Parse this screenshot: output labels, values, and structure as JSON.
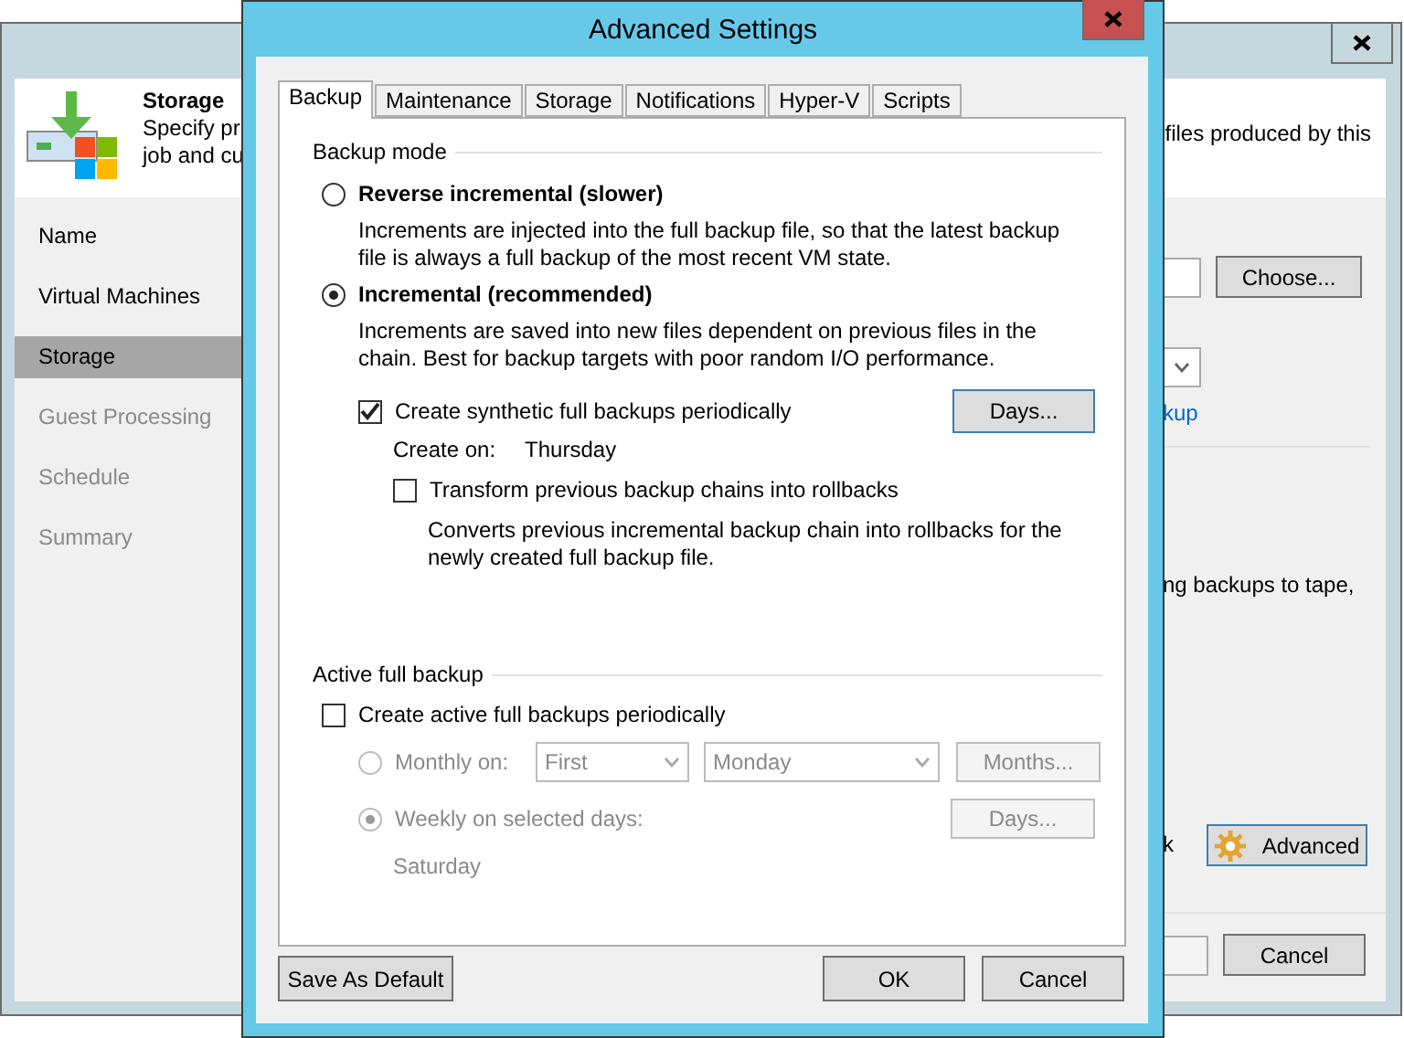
{
  "background_window": {
    "header": {
      "title": "Storage",
      "description_left": [
        "Specify pr",
        "job and cu"
      ],
      "description_right": "files produced by this"
    },
    "nav": [
      {
        "label": "Name",
        "selected": false,
        "disabled": false
      },
      {
        "label": "Virtual Machines",
        "selected": false,
        "disabled": false
      },
      {
        "label": "Storage",
        "selected": true,
        "disabled": false
      },
      {
        "label": "Guest Processing",
        "selected": false,
        "disabled": true
      },
      {
        "label": "Schedule",
        "selected": false,
        "disabled": true
      },
      {
        "label": "Summary",
        "selected": false,
        "disabled": true
      }
    ],
    "choose_button": "Choose...",
    "link": "kup",
    "fragment_tape": "ng backups to tape,",
    "fragment_k": "k",
    "advanced_button": "Advanced",
    "cancel_button": "Cancel"
  },
  "dialog": {
    "title": "Advanced Settings",
    "tabs": [
      {
        "label": "Backup",
        "selected": true
      },
      {
        "label": "Maintenance",
        "selected": false
      },
      {
        "label": "Storage",
        "selected": false
      },
      {
        "label": "Notifications",
        "selected": false
      },
      {
        "label": "Hyper-V",
        "selected": false
      },
      {
        "label": "Scripts",
        "selected": false
      }
    ],
    "backup_mode": {
      "heading": "Backup mode",
      "options": [
        {
          "label": "Reverse incremental (slower)",
          "selected": false,
          "description": "Increments are injected into the full backup file, so that the latest backup file is always a full backup of the most recent VM state."
        },
        {
          "label": "Incremental (recommended)",
          "selected": true,
          "description": "Increments are saved into new files dependent on previous files in the chain. Best for backup targets with poor random I/O performance."
        }
      ]
    },
    "synthetic": {
      "label": "Create synthetic full backups periodically",
      "checked": true,
      "button": "Days...",
      "create_on_label": "Create on:",
      "create_on_value": "Thursday",
      "transform": {
        "label": "Transform previous backup chains into rollbacks",
        "checked": false,
        "description": "Converts previous incremental backup chain into rollbacks for the newly created full backup file."
      }
    },
    "active_full": {
      "heading": "Active full backup",
      "checkbox": {
        "label": "Create active full backups periodically",
        "checked": false
      },
      "monthly": {
        "label": "Monthly on:",
        "selected": false,
        "disabled": true,
        "week": "First",
        "day": "Monday",
        "button": "Months..."
      },
      "weekly": {
        "label": "Weekly on selected days:",
        "selected": true,
        "disabled": true,
        "button": "Days...",
        "days": "Saturday"
      }
    },
    "buttons": {
      "save_default": "Save As Default",
      "ok": "OK",
      "cancel": "Cancel"
    }
  }
}
